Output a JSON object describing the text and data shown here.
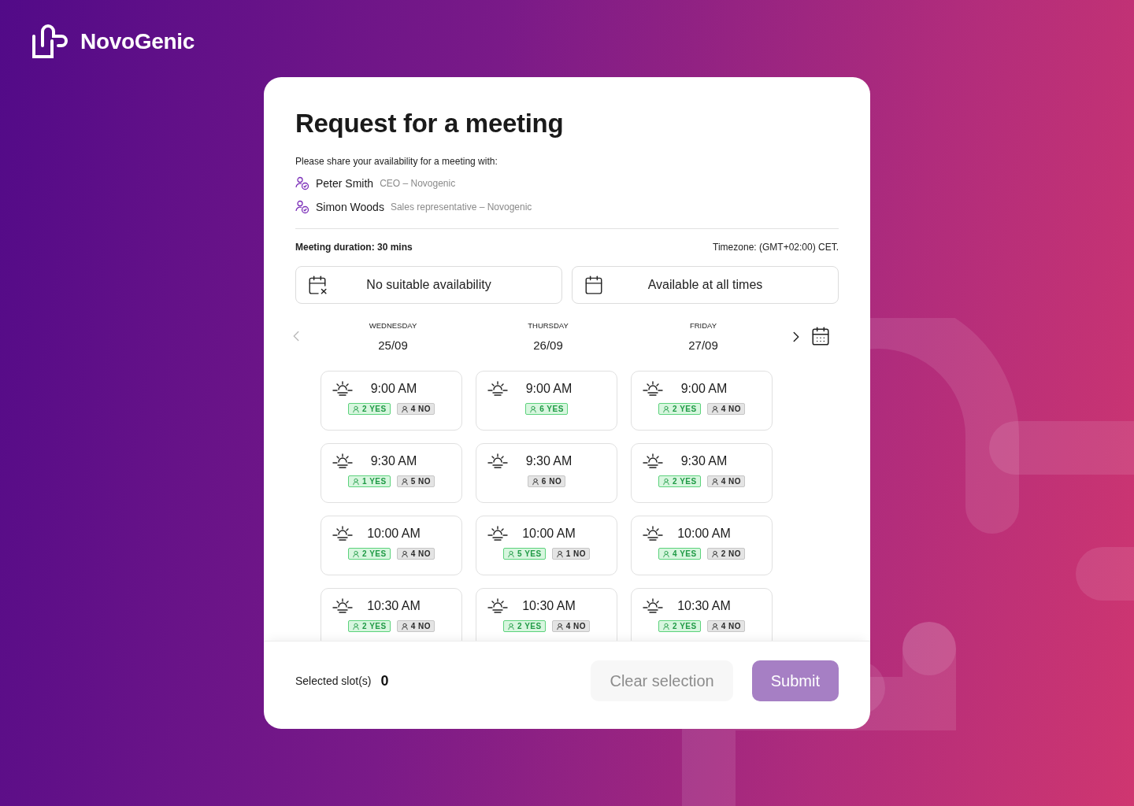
{
  "brand": {
    "name": "NovoGenic"
  },
  "title": "Request for a meeting",
  "intro": "Please share your availability for a meeting with:",
  "attendees": [
    {
      "name": "Peter Smith",
      "role": "CEO – Novogenic"
    },
    {
      "name": "Simon Woods",
      "role": "Sales representative – Novogenic"
    }
  ],
  "duration": "Meeting duration: 30 mins",
  "timezone": "Timezone: (GMT+02:00) CET.",
  "options": [
    {
      "kind": "none",
      "label": "No suitable availability"
    },
    {
      "kind": "all",
      "label": "Available at all times"
    }
  ],
  "navigation": {
    "prev_disabled": true,
    "next_disabled": false
  },
  "days": [
    {
      "weekday": "WEDNESDAY",
      "date": "25/09",
      "slots": [
        {
          "time": "9:00 AM",
          "badges": [
            {
              "kind": "yes",
              "label": "2 YES"
            },
            {
              "kind": "no",
              "label": "4 NO"
            }
          ]
        },
        {
          "time": "9:30 AM",
          "badges": [
            {
              "kind": "yes",
              "label": "1 YES"
            },
            {
              "kind": "no",
              "label": "5 NO"
            }
          ]
        },
        {
          "time": "10:00 AM",
          "badges": [
            {
              "kind": "yes",
              "label": "2 YES"
            },
            {
              "kind": "no",
              "label": "4 NO"
            }
          ]
        },
        {
          "time": "10:30 AM",
          "badges": [
            {
              "kind": "yes",
              "label": "2 YES"
            },
            {
              "kind": "no",
              "label": "4 NO"
            }
          ]
        }
      ]
    },
    {
      "weekday": "THURSDAY",
      "date": "26/09",
      "slots": [
        {
          "time": "9:00 AM",
          "badges": [
            {
              "kind": "yes",
              "label": "6 YES"
            }
          ]
        },
        {
          "time": "9:30 AM",
          "badges": [
            {
              "kind": "no",
              "label": "6 NO"
            }
          ]
        },
        {
          "time": "10:00 AM",
          "badges": [
            {
              "kind": "yes",
              "label": "5 YES"
            },
            {
              "kind": "no",
              "label": "1 NO"
            }
          ]
        },
        {
          "time": "10:30 AM",
          "badges": [
            {
              "kind": "yes",
              "label": "2 YES"
            },
            {
              "kind": "no",
              "label": "4 NO"
            }
          ]
        }
      ]
    },
    {
      "weekday": "FRIDAY",
      "date": "27/09",
      "slots": [
        {
          "time": "9:00 AM",
          "badges": [
            {
              "kind": "yes",
              "label": "2 YES"
            },
            {
              "kind": "no",
              "label": "4 NO"
            }
          ]
        },
        {
          "time": "9:30 AM",
          "badges": [
            {
              "kind": "yes",
              "label": "2 YES"
            },
            {
              "kind": "no",
              "label": "4 NO"
            }
          ]
        },
        {
          "time": "10:00 AM",
          "badges": [
            {
              "kind": "yes",
              "label": "4 YES"
            },
            {
              "kind": "no",
              "label": "2 NO"
            }
          ]
        },
        {
          "time": "10:30 AM",
          "badges": [
            {
              "kind": "yes",
              "label": "2 YES"
            },
            {
              "kind": "no",
              "label": "4 NO"
            }
          ]
        }
      ]
    }
  ],
  "footer": {
    "selected_label": "Selected slot(s)",
    "selected_count": "0",
    "buttons": [
      {
        "kind": "secondary",
        "label": "Clear selection",
        "disabled": true
      },
      {
        "kind": "primary",
        "label": "Submit",
        "disabled": true
      }
    ]
  }
}
